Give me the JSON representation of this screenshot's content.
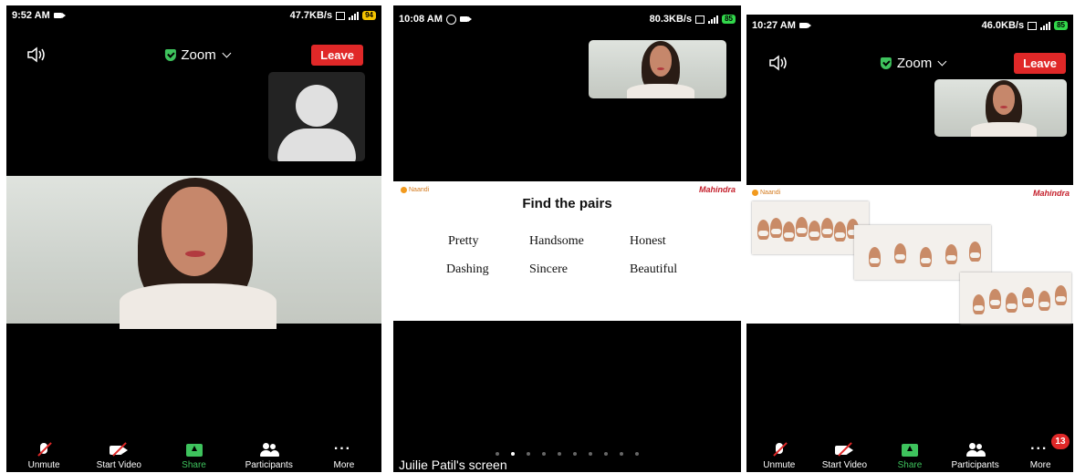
{
  "screen1": {
    "status": {
      "time": "9:52 AM",
      "speed": "47.7KB/s",
      "battery": "94"
    },
    "meeting_title": "Zoom",
    "leave_label": "Leave",
    "toolbar": [
      {
        "label": "Unmute",
        "icon": "mic-muted-icon"
      },
      {
        "label": "Start Video",
        "icon": "video-off-icon"
      },
      {
        "label": "Share",
        "icon": "share-screen-icon"
      },
      {
        "label": "Participants",
        "icon": "participants-icon"
      },
      {
        "label": "More",
        "icon": "more-icon"
      }
    ]
  },
  "screen2": {
    "status": {
      "time": "10:08 AM",
      "speed": "80.3KB/s",
      "battery": "85"
    },
    "slide": {
      "title": "Find the pairs",
      "logo_left": "Naandi",
      "logo_right": "Mahindra",
      "words": [
        "Pretty",
        "Handsome",
        "Honest",
        "Dashing",
        "Sincere",
        "Beautiful"
      ]
    },
    "screen_label": "Juilie Patil's screen",
    "pager_count": 10,
    "pager_active": 1
  },
  "screen3": {
    "status": {
      "time": "10:27 AM",
      "speed": "46.0KB/s",
      "battery": "85"
    },
    "meeting_title": "Zoom",
    "leave_label": "Leave",
    "slide": {
      "logo_left": "Naandi",
      "logo_right": "Mahindra"
    },
    "more_badge": "13",
    "toolbar": [
      {
        "label": "Unmute",
        "icon": "mic-muted-icon"
      },
      {
        "label": "Start Video",
        "icon": "video-off-icon"
      },
      {
        "label": "Share",
        "icon": "share-screen-icon"
      },
      {
        "label": "Participants",
        "icon": "participants-icon"
      },
      {
        "label": "More",
        "icon": "more-icon"
      }
    ]
  },
  "colors": {
    "leave": "#e02828",
    "share": "#3ec35d",
    "shield": "#3ec35d"
  }
}
